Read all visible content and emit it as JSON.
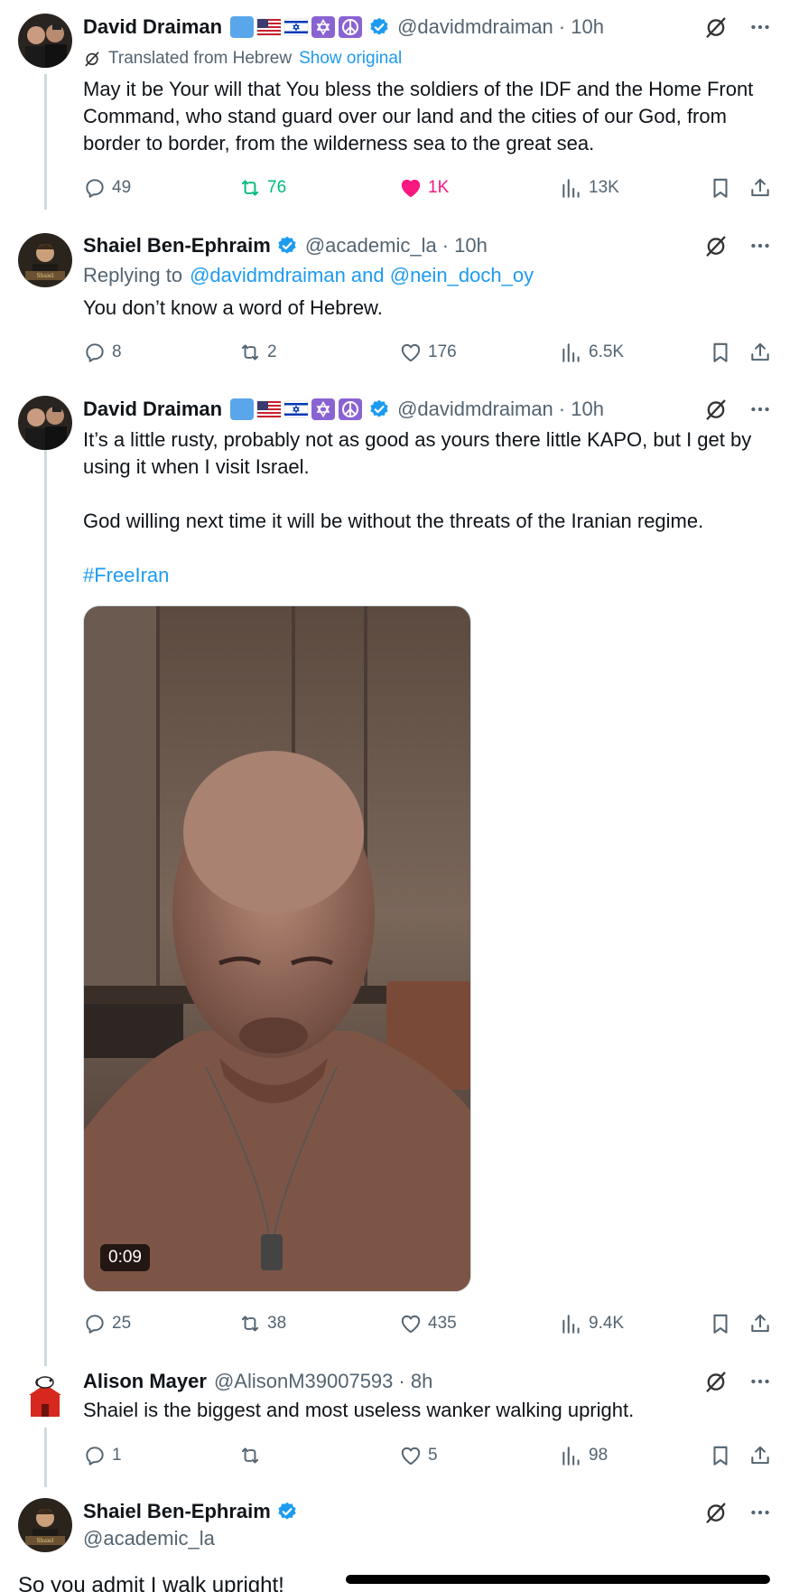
{
  "colors": {
    "accent": "#1d9bf0",
    "retweet": "#00ba7c",
    "like": "#f91880",
    "muted": "#536471"
  },
  "tweets": [
    {
      "name": "David Draiman",
      "handle": "@davidmdraiman",
      "time": "· 10h",
      "translated_label": "Translated from Hebrew",
      "show_original": "Show original",
      "text": "May it be Your will that You bless the soldiers of the IDF and the Home Front Command, who stand guard over our land and the cities of our God, from border to border, from the wilderness sea to the great sea.",
      "stats": {
        "replies": "49",
        "retweets": "76",
        "likes": "1K",
        "views": "13K"
      },
      "retweeted": true,
      "liked": true
    },
    {
      "name": "Shaiel Ben-Ephraim",
      "handle": "@academic_la",
      "time": "· 10h",
      "replying_prefix": "Replying to",
      "replying_to": "@davidmdraiman and @nein_doch_oy",
      "text": "You don’t know a word of Hebrew.",
      "stats": {
        "replies": "8",
        "retweets": "2",
        "likes": "176",
        "views": "6.5K"
      }
    },
    {
      "name": "David Draiman",
      "handle": "@davidmdraiman",
      "time": "· 10h",
      "text_p1": "It’s a little rusty, probably not as good as yours there little KAPO, but I get by using it when I visit Israel.",
      "text_p2": "God willing next time it will be without the threats of the Iranian regime.",
      "hashtag": "#FreeIran",
      "video_duration": "0:09",
      "stats": {
        "replies": "25",
        "retweets": "38",
        "likes": "435",
        "views": "9.4K"
      }
    },
    {
      "name": "Alison Mayer",
      "handle": "@AlisonM39007593",
      "time": "· 8h",
      "text": "Shaiel is the biggest and most useless wanker walking upright.",
      "stats": {
        "replies": "1",
        "retweets": "",
        "likes": "5",
        "views": "98"
      }
    },
    {
      "name": "Shaiel Ben-Ephraim",
      "handle": "@academic_la",
      "text": "So you admit I walk upright!"
    }
  ]
}
